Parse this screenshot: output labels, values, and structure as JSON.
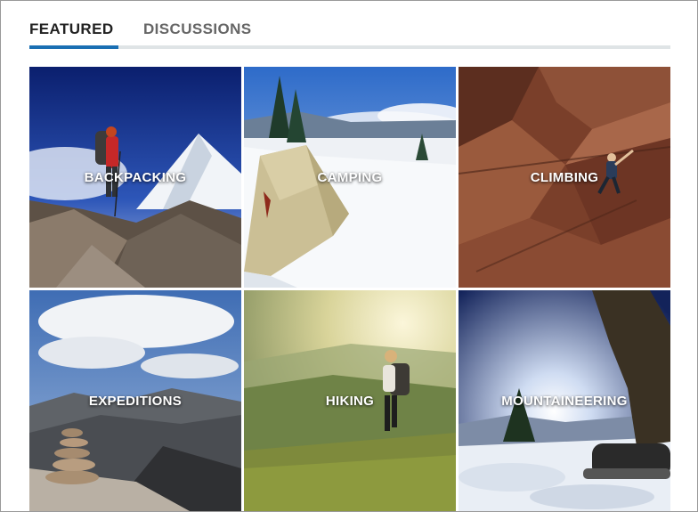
{
  "tabs": {
    "featured": "FEATURED",
    "discussions": "DISCUSSIONS"
  },
  "active_tab": "featured",
  "accent_color": "#1a6fb3",
  "tiles": [
    {
      "label": "BACKPACKING"
    },
    {
      "label": "CAMPING"
    },
    {
      "label": "CLIMBING"
    },
    {
      "label": "EXPEDITIONS"
    },
    {
      "label": "HIKING"
    },
    {
      "label": "MOUNTAINEERING"
    }
  ]
}
